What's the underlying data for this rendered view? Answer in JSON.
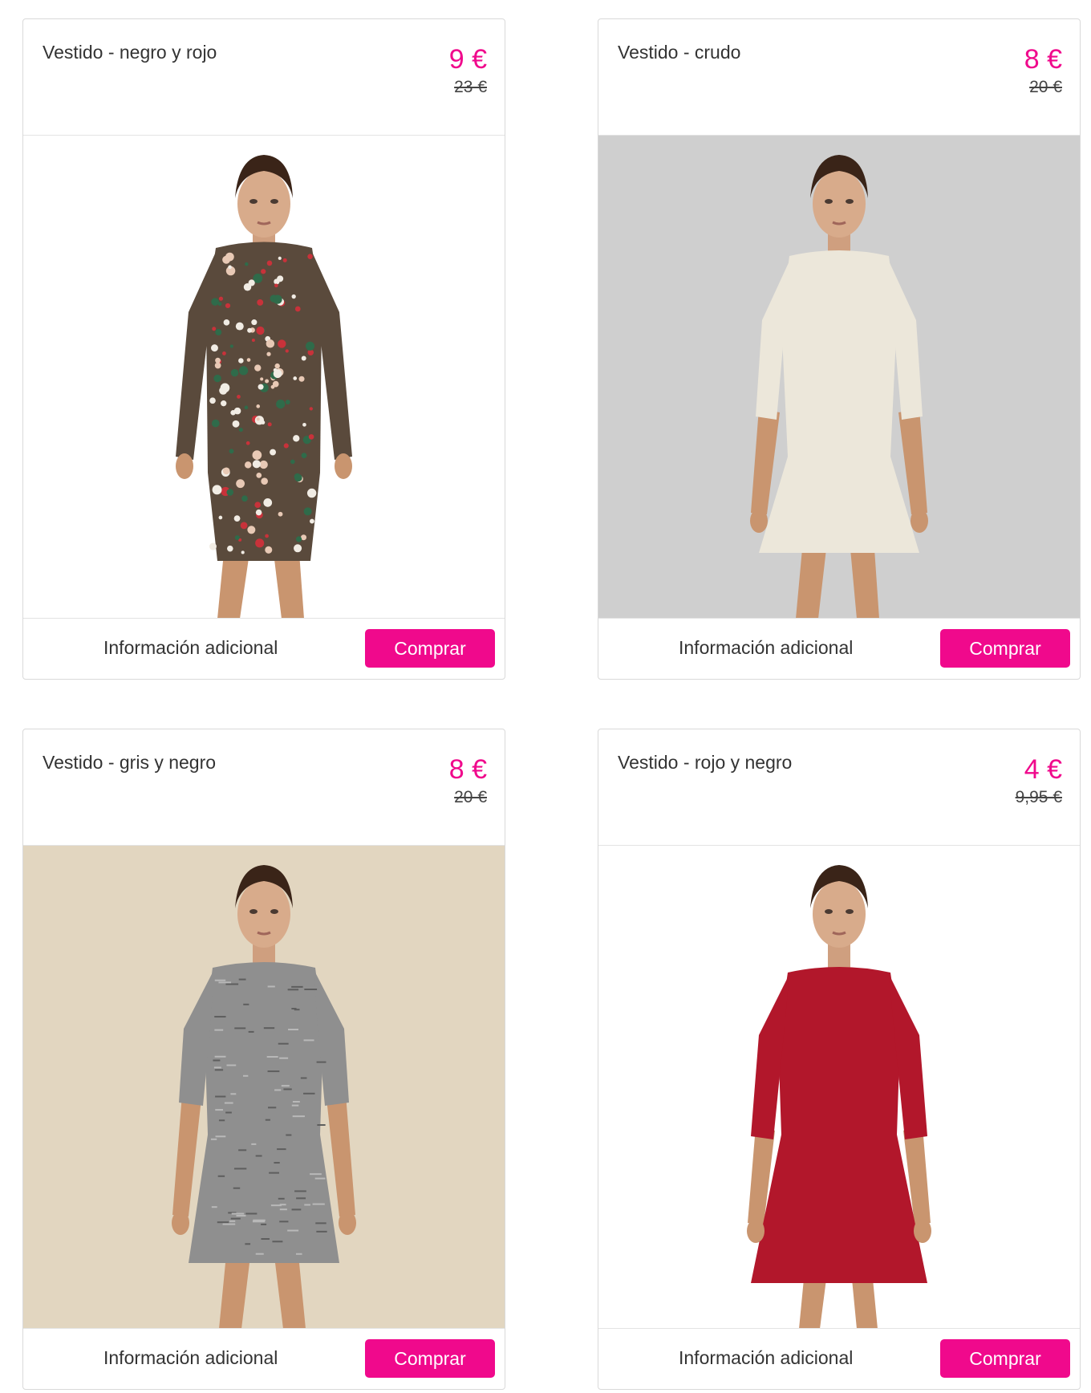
{
  "products": [
    {
      "title": "Vestido - negro y rojo",
      "price": "9 €",
      "old_price": "23 €",
      "info_label": "Información adicional",
      "buy_label": "Comprar",
      "background_color": "#ffffff",
      "dress_color": "#5a4a3c",
      "pattern": "floral"
    },
    {
      "title": "Vestido - crudo",
      "price": "8 €",
      "old_price": "20 €",
      "info_label": "Información adicional",
      "buy_label": "Comprar",
      "background_color": "#cfcfcf",
      "dress_color": "#ece7da",
      "pattern": "plain"
    },
    {
      "title": "Vestido - gris y negro",
      "price": "8 €",
      "old_price": "20 €",
      "info_label": "Información adicional",
      "buy_label": "Comprar",
      "background_color": "#e2d6c0",
      "dress_color": "#8f8f8f",
      "pattern": "marled"
    },
    {
      "title": "Vestido - rojo y negro",
      "price": "4 €",
      "old_price": "9,95 €",
      "info_label": "Información adicional",
      "buy_label": "Comprar",
      "background_color": "#ffffff",
      "dress_color": "#b2172b",
      "pattern": "plain"
    }
  ],
  "theme": {
    "accent_color": "#f0098c"
  }
}
